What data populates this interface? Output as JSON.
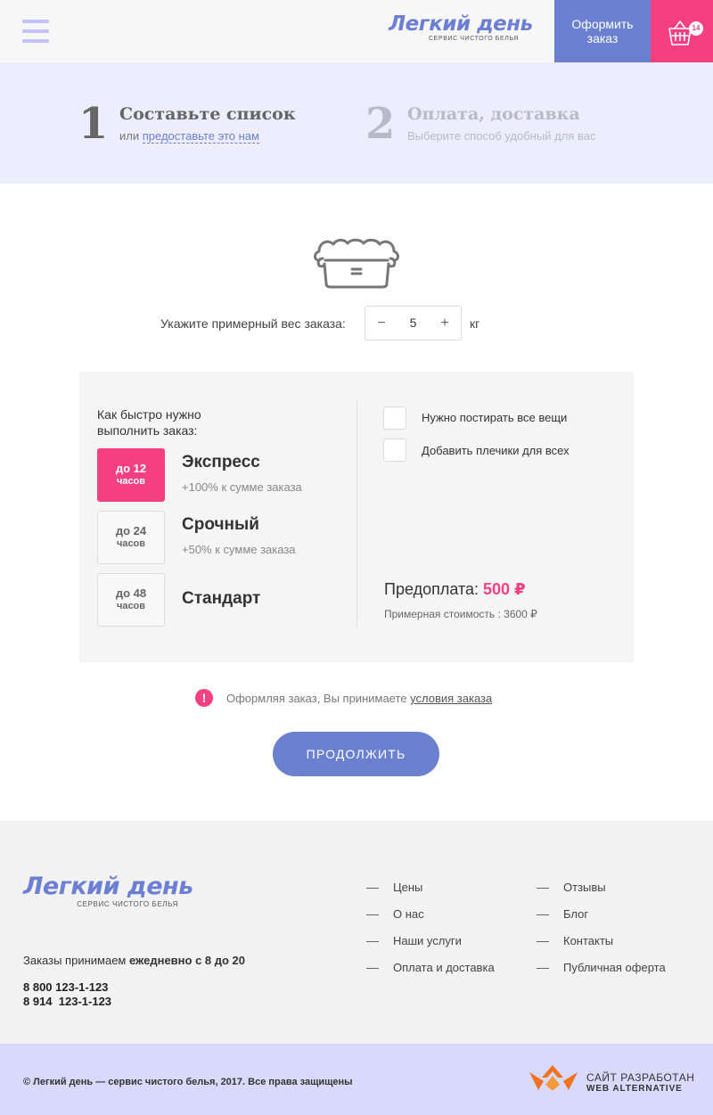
{
  "header": {
    "logo_name": "Легкий день",
    "logo_tagline": "сервис чистого белья",
    "order_button": "Оформить заказ",
    "cart_count": "14"
  },
  "steps": [
    {
      "number": "1",
      "title": "Составьте список",
      "sub_prefix": "или",
      "sub_link": "предоставьте это нам"
    },
    {
      "number": "2",
      "title": "Оплата, доставка",
      "sub": "Выберите способ удобный для вас"
    }
  ],
  "weight": {
    "label": "Укажите примерный вес заказа:",
    "minus": "−",
    "plus": "+",
    "value": "5",
    "unit": "кг"
  },
  "speed": {
    "question": "Как быстро нужно выполнить заказ:",
    "options": [
      {
        "box_line1": "до 12",
        "box_line2": "часов",
        "title": "Экспресс",
        "sub": "+100% к сумме заказа",
        "active": true
      },
      {
        "box_line1": "до 24",
        "box_line2": "часов",
        "title": "Срочный",
        "sub": "+50% к сумме заказа",
        "active": false
      },
      {
        "box_line1": "до 48",
        "box_line2": "часов",
        "title": "Стандарт",
        "sub": "",
        "active": false
      }
    ]
  },
  "extras": [
    {
      "label": "Нужно постирать все вещи",
      "checked": false
    },
    {
      "label": "Добавить плечики для всех",
      "checked": false
    }
  ],
  "summary": {
    "prepay_label": "Предоплата:",
    "prepay_value": "500 ₽",
    "approx": "Примерная стоимость : 3600 ₽"
  },
  "terms": {
    "icon": "!",
    "text": "Оформляя заказ, Вы принимаете",
    "link": "условия заказа"
  },
  "continue_button": "ПРОДОЛЖИТЬ",
  "footer": {
    "logo_name": "Легкий день",
    "logo_tagline": "сервис чистого белья",
    "hours_prefix": "Заказы  принимаем",
    "hours_bold": "ежедневно с 8 до 20",
    "phones": [
      "8 800 123-1-123",
      "8 914  123-1-123"
    ],
    "nav_col1": [
      "Цены",
      "О нас",
      "Наши услуги",
      "Оплата и доставка"
    ],
    "nav_col2": [
      "Отзывы",
      "Блог",
      "Контакты",
      "Публичная оферта"
    ],
    "copyright": "© Легкий день — сервис чистого белья, 2017. Все права защищены",
    "dev_line1": "САЙТ РАЗРАБОТАН",
    "dev_line2": "WEB ALTERNATIVE"
  },
  "colors": {
    "accent_blue": "#6b81d0",
    "accent_pink": "#f4407e",
    "steps_bg": "#ededfd",
    "bottom_bg": "#d9d9fc"
  },
  "icons": [
    "menu-icon",
    "cart-icon",
    "laundry-basket-icon",
    "warning-icon",
    "web-alternative-logo-icon"
  ]
}
